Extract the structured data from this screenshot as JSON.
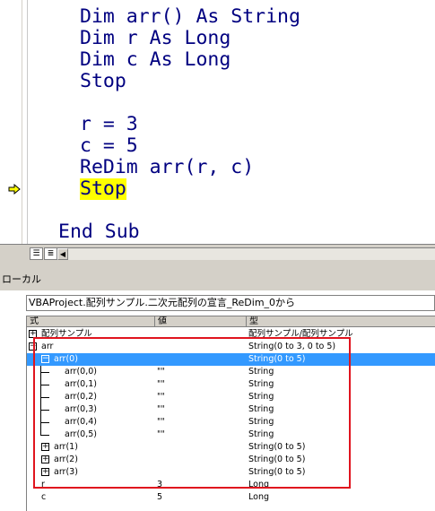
{
  "code_lines": [
    "Dim arr() As String",
    "Dim r As Long",
    "Dim c As Long",
    "Stop",
    "r = 3",
    "c = 5",
    "ReDim arr(r, c)",
    "Stop",
    "End Sub"
  ],
  "locals": {
    "title": "ローカル",
    "context": "VBAProject.配列サンプル.二次元配列の宣言_ReDim_0から",
    "headers": {
      "expression": "式",
      "value": "値",
      "type": "型"
    },
    "rows": [
      {
        "name": "配列サンプル",
        "value": "",
        "type": "配列サンプル/配列サンプル",
        "toggle": "+"
      },
      {
        "name": "arr",
        "value": "",
        "type": "String(0 to 3, 0 to 5)",
        "toggle": "−"
      },
      {
        "name": "arr(0)",
        "value": "",
        "type": "String(0 to 5)",
        "toggle": "−"
      },
      {
        "name": "arr(0,0)",
        "value": "\"\"",
        "type": "String",
        "toggle": ""
      },
      {
        "name": "arr(0,1)",
        "value": "\"\"",
        "type": "String",
        "toggle": ""
      },
      {
        "name": "arr(0,2)",
        "value": "\"\"",
        "type": "String",
        "toggle": ""
      },
      {
        "name": "arr(0,3)",
        "value": "\"\"",
        "type": "String",
        "toggle": ""
      },
      {
        "name": "arr(0,4)",
        "value": "\"\"",
        "type": "String",
        "toggle": ""
      },
      {
        "name": "arr(0,5)",
        "value": "\"\"",
        "type": "String",
        "toggle": ""
      },
      {
        "name": "arr(1)",
        "value": "",
        "type": "String(0 to 5)",
        "toggle": "+"
      },
      {
        "name": "arr(2)",
        "value": "",
        "type": "String(0 to 5)",
        "toggle": "+"
      },
      {
        "name": "arr(3)",
        "value": "",
        "type": "String(0 to 5)",
        "toggle": "+"
      },
      {
        "name": "r",
        "value": "3",
        "type": "Long",
        "toggle": ""
      },
      {
        "name": "c",
        "value": "5",
        "type": "Long",
        "toggle": ""
      }
    ]
  },
  "colors": {
    "keyword": "#000080",
    "highlight": "#ffff00",
    "selection": "#3399ff",
    "annotation_box": "#e0141e"
  }
}
